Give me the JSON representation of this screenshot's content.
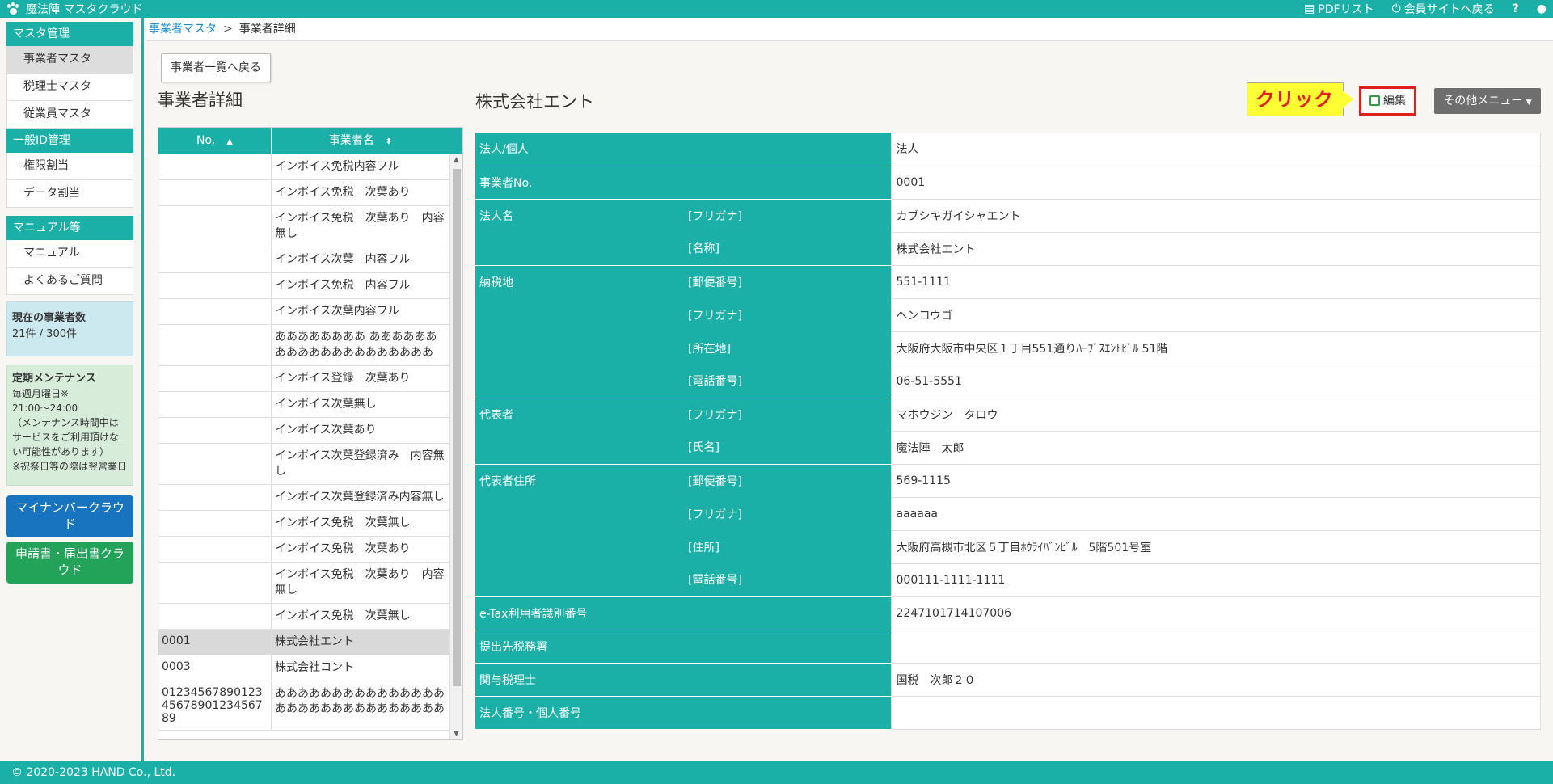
{
  "app": {
    "title": "魔法陣 マスタクラウド",
    "pdf_list": "PDFリスト",
    "member_site": "会員サイトへ戻る",
    "help": "?"
  },
  "sidebar": {
    "sections": [
      {
        "head": "マスタ管理",
        "items": [
          "事業者マスタ",
          "税理士マスタ",
          "従業員マスタ"
        ]
      },
      {
        "head": "一般ID管理",
        "items": [
          "権限割当",
          "データ割当"
        ]
      },
      {
        "head": "マニュアル等",
        "items": [
          "マニュアル",
          "よくあるご質問"
        ]
      }
    ],
    "count_title": "現在の事業者数",
    "count_value": "21件 / 300件",
    "maintenance_title": "定期メンテナンス",
    "maintenance_text_1": "毎週月曜日※",
    "maintenance_text_2": "21:00〜24:00",
    "maintenance_text_3": "（メンテナンス時間中はサービスをご利用頂けない可能性があります）",
    "maintenance_text_4": "※祝祭日等の際は翌営業日",
    "mynumber_button": "マイナンバークラウド",
    "application_button": "申請書・届出書クラウド"
  },
  "breadcrumb": {
    "parent": "事業者マスタ",
    "separator": ">",
    "current": "事業者詳細"
  },
  "back_button": "事業者一覧へ戻る",
  "left_title": "事業者詳細",
  "list": {
    "col_no": "No.",
    "col_name": "事業者名",
    "rows": [
      {
        "no": "",
        "name": "インボイス免税内容フル"
      },
      {
        "no": "",
        "name": "インボイス免税　次葉あり"
      },
      {
        "no": "",
        "name": "インボイス免税　次葉あり　内容無し"
      },
      {
        "no": "",
        "name": "インボイス次葉　内容フル"
      },
      {
        "no": "",
        "name": "インボイス免税　内容フル"
      },
      {
        "no": "",
        "name": "インボイス次葉内容フル"
      },
      {
        "no": "",
        "name": "ああああああああ ああああああああああああああああああああ"
      },
      {
        "no": "",
        "name": "インボイス登録　次葉あり"
      },
      {
        "no": "",
        "name": "インボイス次葉無し"
      },
      {
        "no": "",
        "name": "インボイス次葉あり"
      },
      {
        "no": "",
        "name": "インボイス次葉登録済み　内容無し"
      },
      {
        "no": "",
        "name": "インボイス次葉登録済み内容無し"
      },
      {
        "no": "",
        "name": "インボイス免税　次葉無し"
      },
      {
        "no": "",
        "name": "インボイス免税　次葉あり"
      },
      {
        "no": "",
        "name": "インボイス免税　次葉あり　内容無し"
      },
      {
        "no": "",
        "name": "インボイス免税　次葉無し"
      },
      {
        "no": "0001",
        "name": "株式会社エント"
      },
      {
        "no": "0003",
        "name": "株式会社コント"
      },
      {
        "no": "012345678901234567890123456789",
        "name": "ああああああああああああああああああああああああああああああ"
      }
    ]
  },
  "main_title": "株式会社エント",
  "callout": "クリック",
  "edit_button": "編集",
  "menu_button": "その他メニュー",
  "detail": [
    {
      "label": "法人/個人",
      "sub": "",
      "value": "法人",
      "end": true
    },
    {
      "label": "事業者No.",
      "sub": "",
      "value": "0001",
      "end": true
    },
    {
      "label": "法人名",
      "sub": "[フリガナ]",
      "value": "カブシキガイシャエント",
      "end": false
    },
    {
      "label": "",
      "sub": "[名称]",
      "value": "株式会社エント",
      "end": true
    },
    {
      "label": "納税地",
      "sub": "[郵便番号]",
      "value": "551-1111",
      "end": false
    },
    {
      "label": "",
      "sub": "[フリガナ]",
      "value": "ヘンコウゴ",
      "end": false
    },
    {
      "label": "",
      "sub": "[所在地]",
      "value": "大阪府大阪市中央区１丁目551通りﾊｰﾌﾞｽｴﾝﾄﾋﾞﾙ 51階",
      "end": false
    },
    {
      "label": "",
      "sub": "[電話番号]",
      "value": "06-51-5551",
      "end": true
    },
    {
      "label": "代表者",
      "sub": "[フリガナ]",
      "value": "マホウジン　タロウ",
      "end": false
    },
    {
      "label": "",
      "sub": "[氏名]",
      "value": "魔法陣　太郎",
      "end": true
    },
    {
      "label": "代表者住所",
      "sub": "[郵便番号]",
      "value": "569-1115",
      "end": false
    },
    {
      "label": "",
      "sub": "[フリガナ]",
      "value": "aaaaaa",
      "end": false
    },
    {
      "label": "",
      "sub": "[住所]",
      "value": "大阪府高槻市北区５丁目ﾎｳﾗｲﾊﾞﾝﾋﾞﾙ　5階501号室",
      "end": false
    },
    {
      "label": "",
      "sub": "[電話番号]",
      "value": "000111-1111-1111",
      "end": true
    },
    {
      "label": "e-Tax利用者識別番号",
      "sub": "",
      "value": "2247101714107006",
      "end": true
    },
    {
      "label": "提出先税務署",
      "sub": "",
      "value": "",
      "end": true
    },
    {
      "label": "関与税理士",
      "sub": "",
      "value": "国税　次郎２０",
      "end": true
    },
    {
      "label": "法人番号・個人番号",
      "sub": "",
      "value": "",
      "end": true
    }
  ],
  "footer": "© 2020-2023 HAND Co., Ltd."
}
